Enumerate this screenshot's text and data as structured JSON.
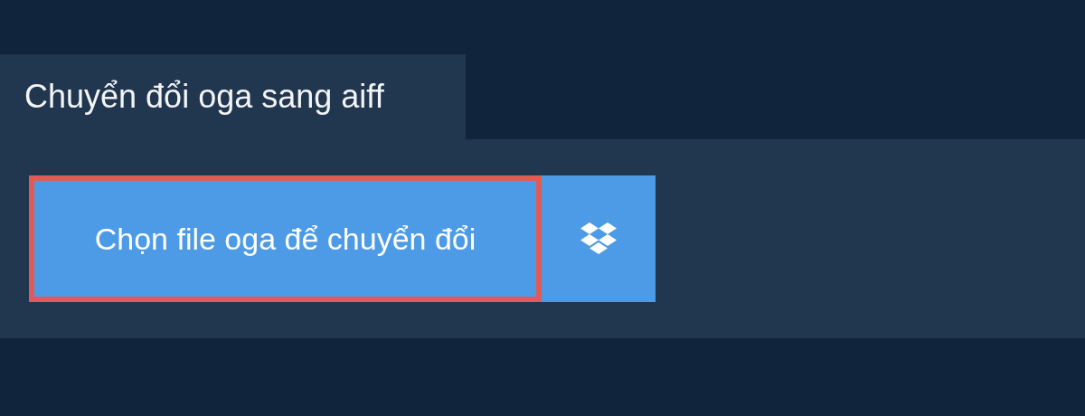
{
  "tab": {
    "title": "Chuyển đổi oga sang aiff",
    "selected": true
  },
  "choose_button": {
    "label": "Chọn file oga để chuyển đổi",
    "focused": true
  }
}
